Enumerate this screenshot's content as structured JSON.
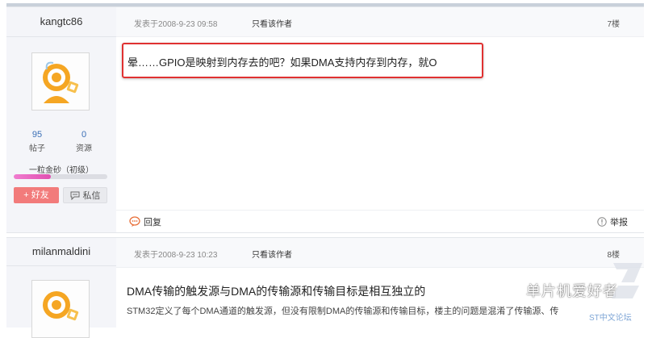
{
  "posts": [
    {
      "username": "kangtc86",
      "stats": {
        "posts_count": "95",
        "posts_label": "帖子",
        "resources_count": "0",
        "resources_label": "资源"
      },
      "rank": "一粒金砂（初级）",
      "progress": 0.4,
      "friend_button": "+ 好友",
      "message_button": "私信",
      "date": "发表于2008-9-23 09:58",
      "only_author": "只看该作者",
      "floor": "7楼",
      "content": "晕……GPIO是映射到内存去的吧？如果DMA支持内存到内存，就O",
      "reply": "回复",
      "report": "举报"
    },
    {
      "username": "milanmaldini",
      "date": "发表于2008-9-23 10:23",
      "only_author": "只看该作者",
      "floor": "8楼",
      "title": "DMA传输的触发源与DMA的传输源和传输目标是相互独立的",
      "content": "STM32定义了每个DMA通道的触发源，但没有限制DMA的传输源和传输目标，楼主的问题是混淆了传输源、传"
    }
  ],
  "watermark": {
    "text": "单片机爱好者",
    "sub": "ST中文论坛"
  },
  "colors": {
    "highlight_border": "#e03131",
    "friend_button": "#f27b7b",
    "progress": "#e14fb1",
    "link": "#3b6fb6"
  }
}
